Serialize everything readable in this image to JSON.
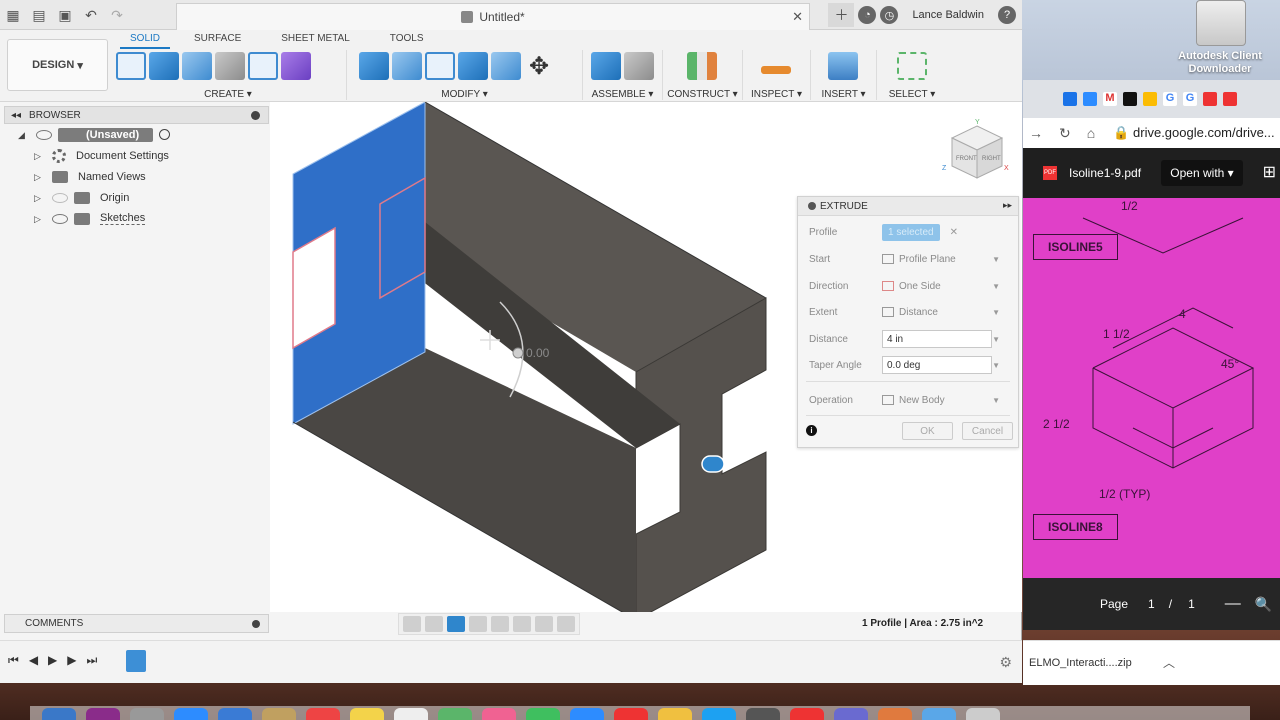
{
  "window": {
    "document_title": "Untitled*",
    "user_name": "Lance Baldwin"
  },
  "toolbar": {
    "workspace": "DESIGN",
    "tabs": [
      "SOLID",
      "SURFACE",
      "SHEET METAL",
      "TOOLS"
    ],
    "active_tab": "SOLID",
    "groups": [
      "CREATE",
      "MODIFY",
      "ASSEMBLE",
      "CONSTRUCT",
      "INSPECT",
      "INSERT",
      "SELECT"
    ]
  },
  "browser": {
    "title": "BROWSER",
    "root": "(Unsaved)",
    "items": [
      "Document Settings",
      "Named Views",
      "Origin",
      "Sketches"
    ]
  },
  "viewport": {
    "dimension_label": "0.00"
  },
  "viewcube": {
    "faces": [
      "FRONT",
      "RIGHT"
    ],
    "axes": [
      "Y",
      "Z",
      "X"
    ]
  },
  "extrude": {
    "title": "EXTRUDE",
    "fields": [
      {
        "label": "Profile",
        "value": "1 selected"
      },
      {
        "label": "Start",
        "value": "Profile Plane"
      },
      {
        "label": "Direction",
        "value": "One Side"
      },
      {
        "label": "Extent",
        "value": "Distance"
      },
      {
        "label": "Distance",
        "value": "4 in"
      },
      {
        "label": "Taper Angle",
        "value": "0.0 deg"
      },
      {
        "label": "Operation",
        "value": "New Body"
      }
    ],
    "ok_label": "OK",
    "cancel_label": "Cancel"
  },
  "comments": {
    "title": "COMMENTS"
  },
  "status": {
    "text": "1 Profile | Area : 2.75 in^2"
  },
  "desktop": {
    "drive_label_line1": "Autodesk Client",
    "drive_label_line2": "Downloader"
  },
  "chrome": {
    "url": "drive.google.com/drive...",
    "pdf_name": "Isoline1-9.pdf",
    "open_with": "Open with",
    "pdf_labels": [
      "ISOLINE5",
      "ISOLINE8"
    ],
    "pdf_annotations": [
      "1/2",
      "4",
      "45°",
      "1 1/2",
      "2 1/2",
      "1/2 (TYP)"
    ],
    "page_label": "Page",
    "page_current": "1",
    "page_sep": "/",
    "page_total": "1",
    "download_file": "ELMO_Interacti....zip"
  },
  "colors": {
    "accent": "#1c79c4",
    "profile_blue": "#2f6fc8",
    "body_dark": "#4d4a47",
    "pdf_magenta": "#e040c8"
  }
}
